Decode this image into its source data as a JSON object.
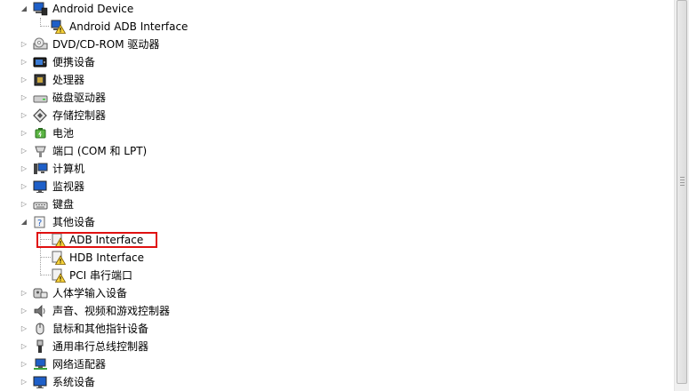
{
  "tree": {
    "android_device": "Android Device",
    "android_adb_interface": "Android ADB Interface",
    "dvd_rom": "DVD/CD-ROM 驱动器",
    "portable": "便携设备",
    "processor": "处理器",
    "disk": "磁盘驱动器",
    "storage": "存储控制器",
    "battery": "电池",
    "ports": "端口 (COM 和 LPT)",
    "computer": "计算机",
    "monitor": "监视器",
    "keyboard": "键盘",
    "other_devices": "其他设备",
    "adb_interface": "ADB Interface",
    "hdb_interface": "HDB Interface",
    "pci_serial": "PCI 串行端口",
    "hid": "人体学输入设备",
    "sound": "声音、视频和游戏控制器",
    "mouse": "鼠标和其他指针设备",
    "usb": "通用串行总线控制器",
    "network": "网络适配器",
    "system": "系统设备"
  },
  "highlight_color": "#e01010"
}
